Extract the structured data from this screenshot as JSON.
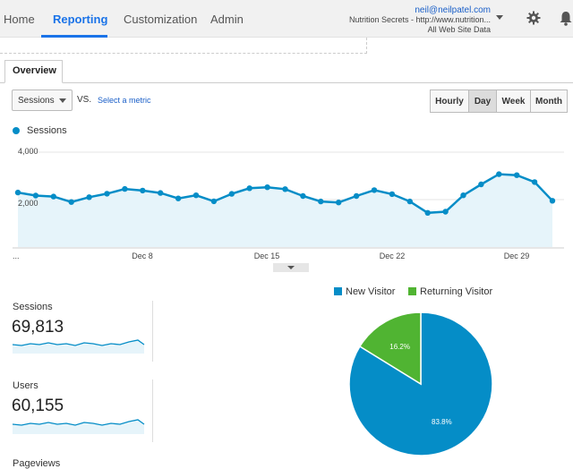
{
  "nav": {
    "items": [
      "Home",
      "Reporting",
      "Customization",
      "Admin"
    ],
    "active": "Reporting"
  },
  "account": {
    "email": "neil@neilpatel.com",
    "property": "Nutrition Secrets - http://www.nutrition...",
    "view": "All Web Site Data"
  },
  "icons": {
    "settings": "gear-icon",
    "notifications": "bell-icon"
  },
  "tabs": {
    "overview": "Overview"
  },
  "controls": {
    "metric_select": "Sessions",
    "vs": "VS.",
    "select_metric": "Select a metric",
    "periods": [
      "Hourly",
      "Day",
      "Week",
      "Month"
    ],
    "selected_period": "Day"
  },
  "chart_data": {
    "type": "area",
    "series": [
      {
        "name": "Sessions",
        "values": [
          2300,
          2170,
          2130,
          1900,
          2100,
          2250,
          2450,
          2380,
          2280,
          2050,
          2180,
          1930,
          2240,
          2480,
          2520,
          2440,
          2150,
          1920,
          1880,
          2150,
          2400,
          2230,
          1920,
          1440,
          1490,
          2180,
          2640,
          3070,
          3030,
          2740,
          1950
        ]
      }
    ],
    "x_tick_labels": [
      "...",
      "Dec 8",
      "Dec 15",
      "Dec 22",
      "Dec 29"
    ],
    "y_tick_labels": [
      "4,000",
      "2,000"
    ],
    "ylim": [
      0,
      4000
    ],
    "grid": true,
    "legend": "top-left",
    "colors": {
      "line": "#058dc7",
      "fill": "#e6f4fa"
    }
  },
  "stats": [
    {
      "label": "Sessions",
      "value": "69,813"
    },
    {
      "label": "Users",
      "value": "60,155"
    },
    {
      "label": "Pageviews",
      "value": ""
    }
  ],
  "pie": {
    "legend": [
      "New Visitor",
      "Returning Visitor"
    ],
    "slices": [
      {
        "name": "New Visitor",
        "value": 83.8,
        "label": "83.8%",
        "color": "#058dc7"
      },
      {
        "name": "Returning Visitor",
        "value": 16.2,
        "label": "16.2%",
        "color": "#50b432"
      }
    ]
  }
}
